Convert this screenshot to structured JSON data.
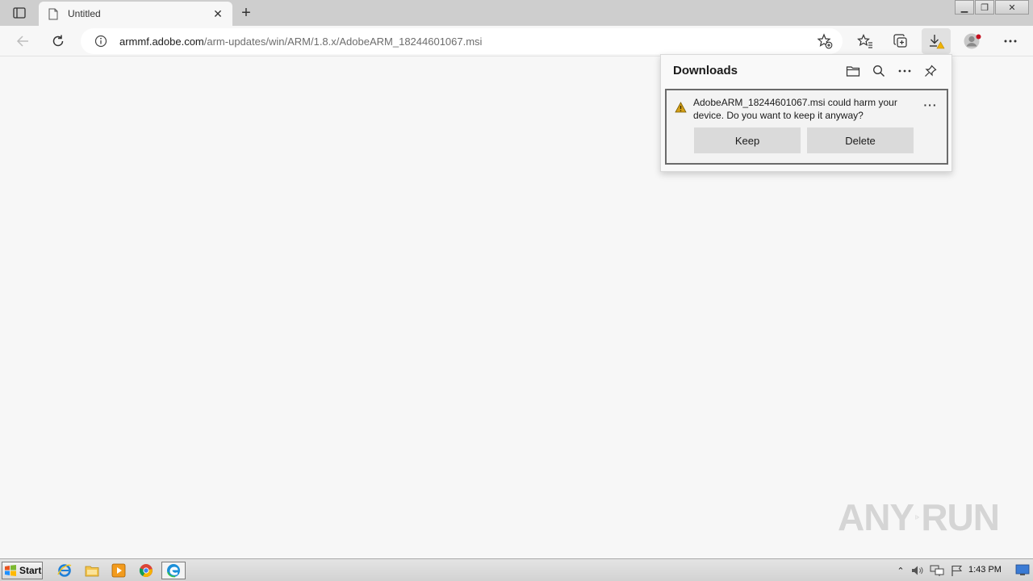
{
  "browser": {
    "tab": {
      "title": "Untitled",
      "close_glyph": "✕"
    },
    "new_tab_glyph": "+",
    "window_controls": {
      "minimize": "▁",
      "maximize": "❐",
      "close": "✕"
    },
    "address": {
      "host": "armmf.adobe.com",
      "path": "/arm-updates/win/ARM/1.8.x/AdobeARM_18244601067.msi"
    },
    "icons": [
      "back-icon",
      "refresh-icon",
      "info-icon",
      "add-favorite-icon",
      "favorites-icon",
      "collections-icon",
      "downloads-icon",
      "profile-icon",
      "more-icon"
    ]
  },
  "downloads": {
    "title": "Downloads",
    "header_icons": [
      "folder-icon",
      "search-icon",
      "more-icon",
      "pin-icon"
    ],
    "item": {
      "message": "AdobeARM_18244601067.msi could harm your device. Do you want to keep it anyway?",
      "more_glyph": "···",
      "keep_label": "Keep",
      "delete_label": "Delete"
    }
  },
  "watermark": {
    "text_left": "ANY",
    "text_right": "RUN"
  },
  "taskbar": {
    "start_label": "Start",
    "clock": "1:43 PM",
    "apps": [
      "internet-explorer-icon",
      "file-explorer-icon",
      "media-player-icon",
      "chrome-icon",
      "edge-icon"
    ],
    "tray_glyphs": {
      "arrow": "⌃"
    }
  },
  "colors": {
    "accent_warning": "#d4a017",
    "profile_dot": "#c50f1f"
  }
}
